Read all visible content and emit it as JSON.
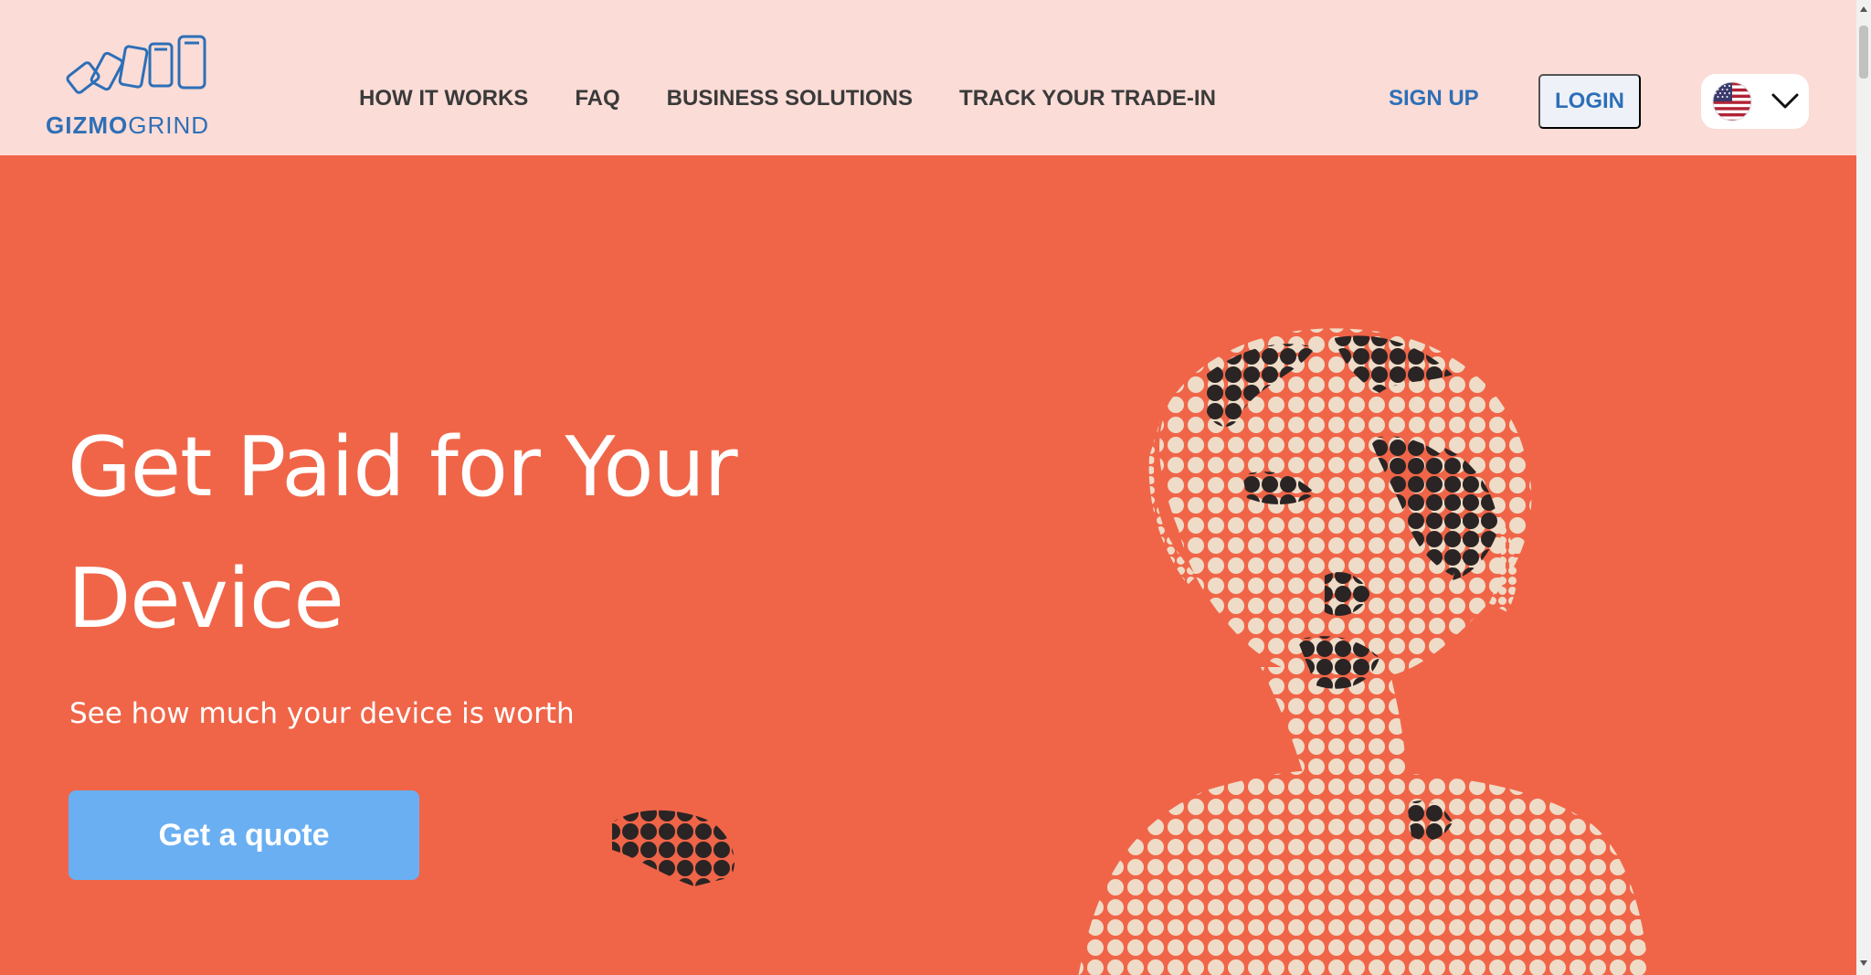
{
  "brand": {
    "logo_bold": "GIZMO",
    "logo_thin": "GRIND",
    "color": "#2d6fb7"
  },
  "nav": {
    "items": [
      {
        "label": "HOW IT WORKS"
      },
      {
        "label": "FAQ"
      },
      {
        "label": "BUSINESS SOLUTIONS"
      },
      {
        "label": "TRACK YOUR TRADE-IN"
      }
    ]
  },
  "account": {
    "signup_label": "SIGN UP",
    "login_label": "LOGIN"
  },
  "language": {
    "selected_icon": "us-flag-icon",
    "dropdown_icon": "chevron-down-icon"
  },
  "hero": {
    "headline": "Get Paid for Your Device",
    "subheadline": "See how much your device is worth",
    "cta_label": "Get a quote",
    "image": "halftone-dot-portrait-illustration"
  },
  "colors": {
    "header_bg": "#fcdcd6",
    "hero_bg": "#f06548",
    "cta_bg": "#6aaff2",
    "nav_text": "#3a3a3a",
    "accent": "#2d6fb7"
  }
}
